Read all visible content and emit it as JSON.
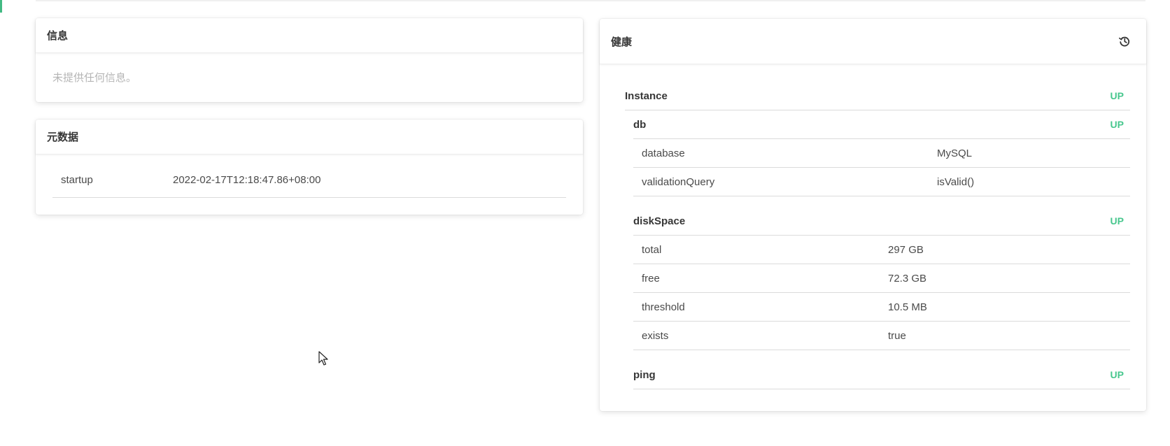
{
  "info_card": {
    "title": "信息",
    "empty_text": "未提供任何信息。"
  },
  "metadata_card": {
    "title": "元数据",
    "rows": [
      {
        "key": "startup",
        "value": "2022-02-17T12:18:47.86+08:00"
      }
    ]
  },
  "health_card": {
    "title": "健康",
    "history_icon": "history-icon",
    "instance": {
      "label": "Instance",
      "status": "UP"
    },
    "db": {
      "label": "db",
      "status": "UP",
      "details": [
        {
          "key": "database",
          "value": "MySQL"
        },
        {
          "key": "validationQuery",
          "value": "isValid()"
        }
      ]
    },
    "diskSpace": {
      "label": "diskSpace",
      "status": "UP",
      "details": [
        {
          "key": "total",
          "value": "297 GB"
        },
        {
          "key": "free",
          "value": "72.3 GB"
        },
        {
          "key": "threshold",
          "value": "10.5 MB"
        },
        {
          "key": "exists",
          "value": "true"
        }
      ]
    },
    "ping": {
      "label": "ping",
      "status": "UP"
    }
  },
  "colors": {
    "status_up": "#48c78e",
    "accent": "#42b983"
  }
}
